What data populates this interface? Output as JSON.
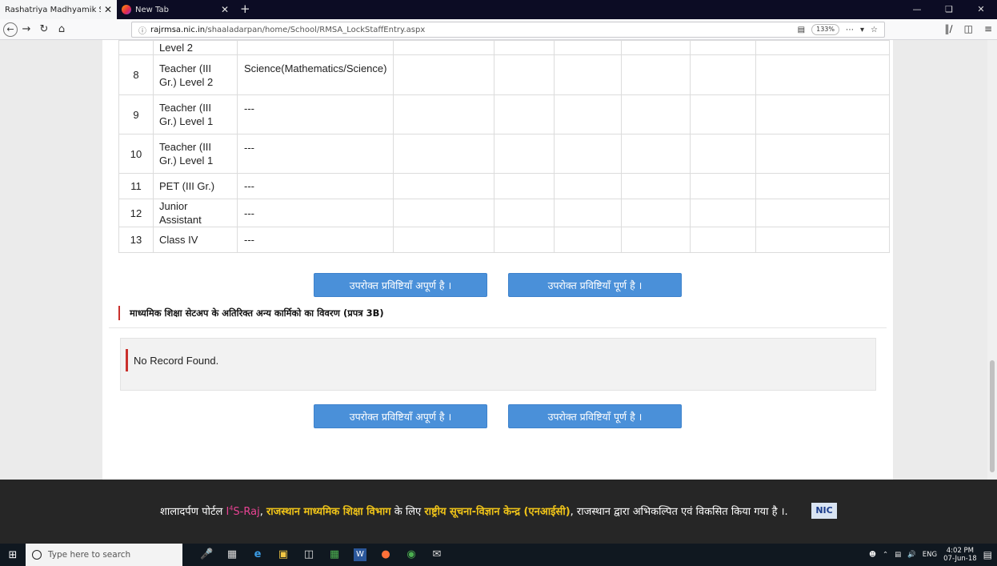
{
  "browser": {
    "tabs": [
      {
        "title": "Rashatriya Madhyamik Shiksha Abhi",
        "close": "✕"
      },
      {
        "title": "New Tab",
        "close": "✕"
      }
    ],
    "new_tab": "+",
    "url_host": "rajrmsa.nic.in",
    "url_path": "/shaaladarpan/home/School/RMSA_LockStaffEntry.aspx",
    "zoom": "133%",
    "page_actions": "⋯"
  },
  "table": {
    "rows": [
      {
        "sno": "",
        "post": "Level 2",
        "subject": ""
      },
      {
        "sno": "8",
        "post": "Teacher (III Gr.) Level 2",
        "subject": "Science(Mathematics/Science)"
      },
      {
        "sno": "9",
        "post": "Teacher (III Gr.) Level 1",
        "subject": "---"
      },
      {
        "sno": "10",
        "post": "Teacher (III Gr.) Level 1",
        "subject": "---"
      },
      {
        "sno": "11",
        "post": "PET (III Gr.)",
        "subject": "---"
      },
      {
        "sno": "12",
        "post": "Junior Assistant",
        "subject": "---"
      },
      {
        "sno": "13",
        "post": "Class IV",
        "subject": "---"
      }
    ]
  },
  "buttons": {
    "incomplete": "उपरोक्त प्रविष्टियाँ अपूर्ण है ।",
    "complete": "उपरोक्त प्रविष्टियाँ पूर्ण है ।"
  },
  "section": {
    "heading": "माध्यमिक शिक्षा सेटअप के अतिरिक्त अन्य कार्मिको का विवरण (प्रपत्र 3B)",
    "no_record": "No Record Found."
  },
  "footer": {
    "prefix": "शालादर्पण पोर्टल ",
    "brand_i": "I",
    "brand_sup": "4",
    "brand_rest": "S-Raj",
    "comma1": ",",
    "dept": "राजस्थान माध्यमिक शिक्षा विभाग",
    "mid": " के लिए ",
    "nic_text": "राष्ट्रीय सूचना-विज्ञान केन्द्र (एनआईसी)",
    "suffix": ", राजस्थान  द्वारा अभिकल्पित एवं  विकसित किया गया है ।.",
    "nic_logo": "NIC"
  },
  "taskbar": {
    "search_placeholder": "Type here to search",
    "lang": "ENG",
    "time": "4:02 PM",
    "date": "07-Jun-18"
  }
}
